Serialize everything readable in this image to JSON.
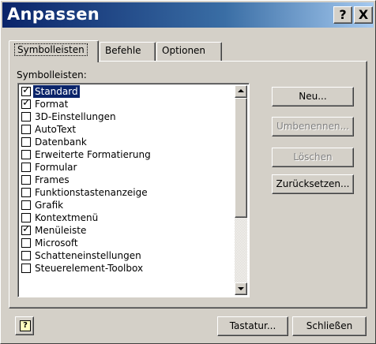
{
  "window": {
    "title": "Anpassen",
    "help_glyph": "?",
    "close_glyph": "X"
  },
  "tabs": [
    {
      "label": "Symbolleisten",
      "active": true
    },
    {
      "label": "Befehle",
      "active": false
    },
    {
      "label": "Optionen",
      "active": false
    }
  ],
  "toolbars": {
    "label": "Symbolleisten:",
    "items": [
      {
        "label": "Standard",
        "checked": true,
        "selected": true
      },
      {
        "label": "Format",
        "checked": true,
        "selected": false
      },
      {
        "label": "3D-Einstellungen",
        "checked": false,
        "selected": false
      },
      {
        "label": "AutoText",
        "checked": false,
        "selected": false
      },
      {
        "label": "Datenbank",
        "checked": false,
        "selected": false
      },
      {
        "label": "Erweiterte Formatierung",
        "checked": false,
        "selected": false
      },
      {
        "label": "Formular",
        "checked": false,
        "selected": false
      },
      {
        "label": "Frames",
        "checked": false,
        "selected": false
      },
      {
        "label": "Funktionstastenanzeige",
        "checked": false,
        "selected": false
      },
      {
        "label": "Grafik",
        "checked": false,
        "selected": false
      },
      {
        "label": "Kontextmenü",
        "checked": false,
        "selected": false
      },
      {
        "label": "Menüleiste",
        "checked": true,
        "selected": false
      },
      {
        "label": "Microsoft",
        "checked": false,
        "selected": false
      },
      {
        "label": "Schatteneinstellungen",
        "checked": false,
        "selected": false
      },
      {
        "label": "Steuerelement-Toolbox",
        "checked": false,
        "selected": false
      }
    ],
    "check_glyph": "✓"
  },
  "buttons": {
    "neu": "Neu...",
    "umbenennen": "Umbenennen...",
    "loeschen": "Löschen",
    "zuruecksetzen": "Zurücksetzen...",
    "tastatur": "Tastatur...",
    "schliessen": "Schließen",
    "help_glyph": "?"
  }
}
